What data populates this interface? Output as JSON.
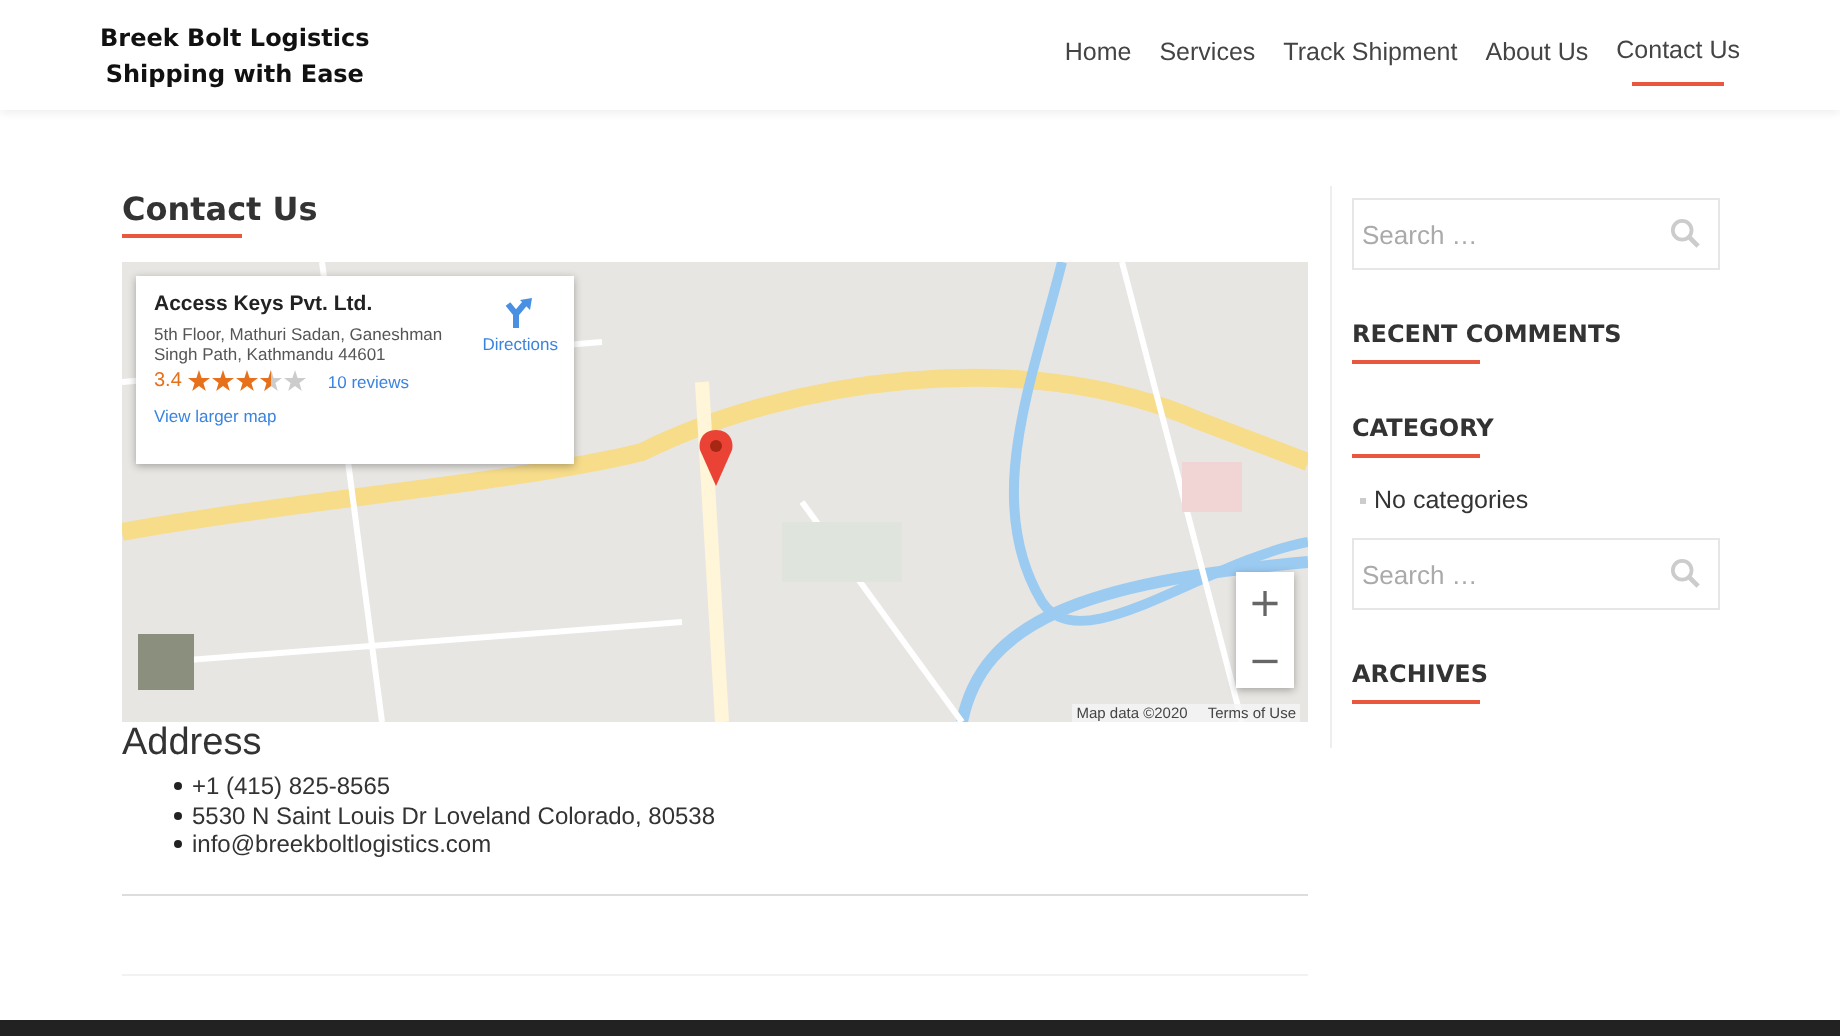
{
  "site": {
    "title_lines": [
      "Breek Bolt Logistics",
      "Shipping with Ease"
    ]
  },
  "nav": [
    {
      "label": "Home",
      "selected": false
    },
    {
      "label": "Services",
      "selected": false
    },
    {
      "label": "Track Shipment",
      "selected": false
    },
    {
      "label": "About Us",
      "selected": false
    },
    {
      "label": "Contact Us",
      "selected": true
    }
  ],
  "page_title": "Contact Us",
  "map": {
    "kind": "picture",
    "card": {
      "name": "Access Keys Pvt. Ltd.",
      "address": "5th Floor, Mathuri Sadan, Ganeshman Singh Path, Kathmandu 44601",
      "rating": "3.4",
      "stars": 3.5,
      "reviews": "10 reviews",
      "directions": "Directions",
      "larger_map": "View larger map"
    },
    "zoom_in": "+",
    "zoom_out": "−",
    "map_data": "Map data ©2020",
    "terms": "Terms of Use"
  },
  "address_heading": "Address",
  "address_items": [
    "+1 (415) 825-8565",
    "5530 N Saint Louis Dr Loveland Colorado, 80538",
    " info@breekboltlogistics.com"
  ],
  "sidebar": [
    {
      "kind": "search",
      "placeholder": "Search …"
    },
    {
      "kind": "heading",
      "title": "RECENT COMMENTS"
    },
    {
      "kind": "heading",
      "title": "CATEGORY"
    },
    {
      "kind": "list",
      "items": [
        "No categories"
      ]
    },
    {
      "kind": "search",
      "placeholder": "Search …"
    },
    {
      "kind": "heading",
      "title": "ARCHIVES"
    }
  ]
}
